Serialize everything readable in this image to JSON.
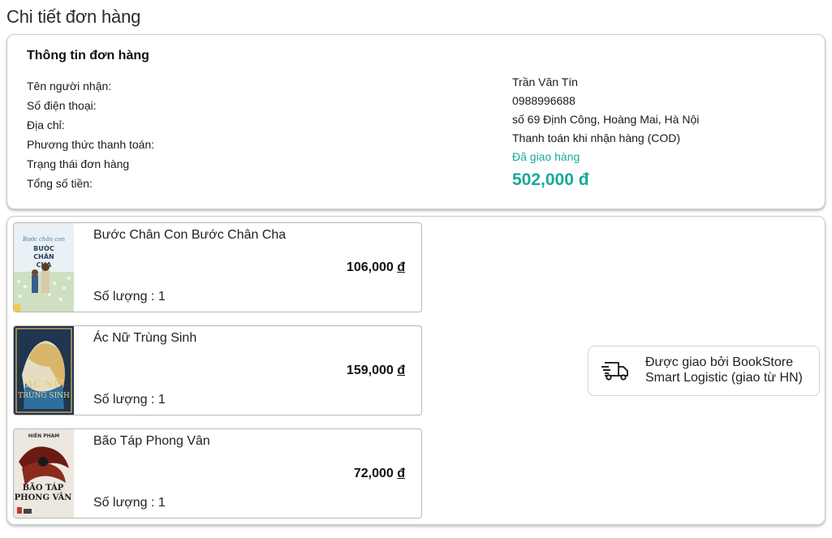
{
  "page": {
    "title": "Chi tiết đơn hàng"
  },
  "order_info": {
    "heading": "Thông tin đơn hàng",
    "labels": [
      "Tên người nhận:",
      "Số điện thoại:",
      "Địa chỉ:",
      "Phương thức thanh toán:",
      "Trạng thái đơn hàng",
      "Tổng số tiền:"
    ],
    "recipient": "Trần Văn Tín",
    "phone": "0988996688",
    "address": "số 69 Định Công, Hoàng Mai, Hà Nội",
    "payment_method": "Thanh toán khi nhận hàng (COD)",
    "status": "Đã giao hàng",
    "total": "502,000 đ",
    "status_color": "#18a999"
  },
  "items": [
    {
      "name": "Bước Chân Con Bước Chân Cha",
      "price": "106,000",
      "currency": "đ",
      "quantity": "Số lượng : 1",
      "cover": "book-cover-image"
    },
    {
      "name": "Ác Nữ Trùng Sinh",
      "price": "159,000",
      "currency": "đ",
      "quantity": "Số lượng : 1",
      "cover": "book-cover-image"
    },
    {
      "name": "Bão Táp Phong Vân",
      "price": "72,000",
      "currency": "đ",
      "quantity": "Số lượng : 1",
      "cover": "book-cover-image"
    }
  ],
  "shipping": {
    "icon": "delivery-truck-icon",
    "line1": "Được giao bởi BookStore",
    "line2": "Smart Logistic (giao từ HN)"
  }
}
